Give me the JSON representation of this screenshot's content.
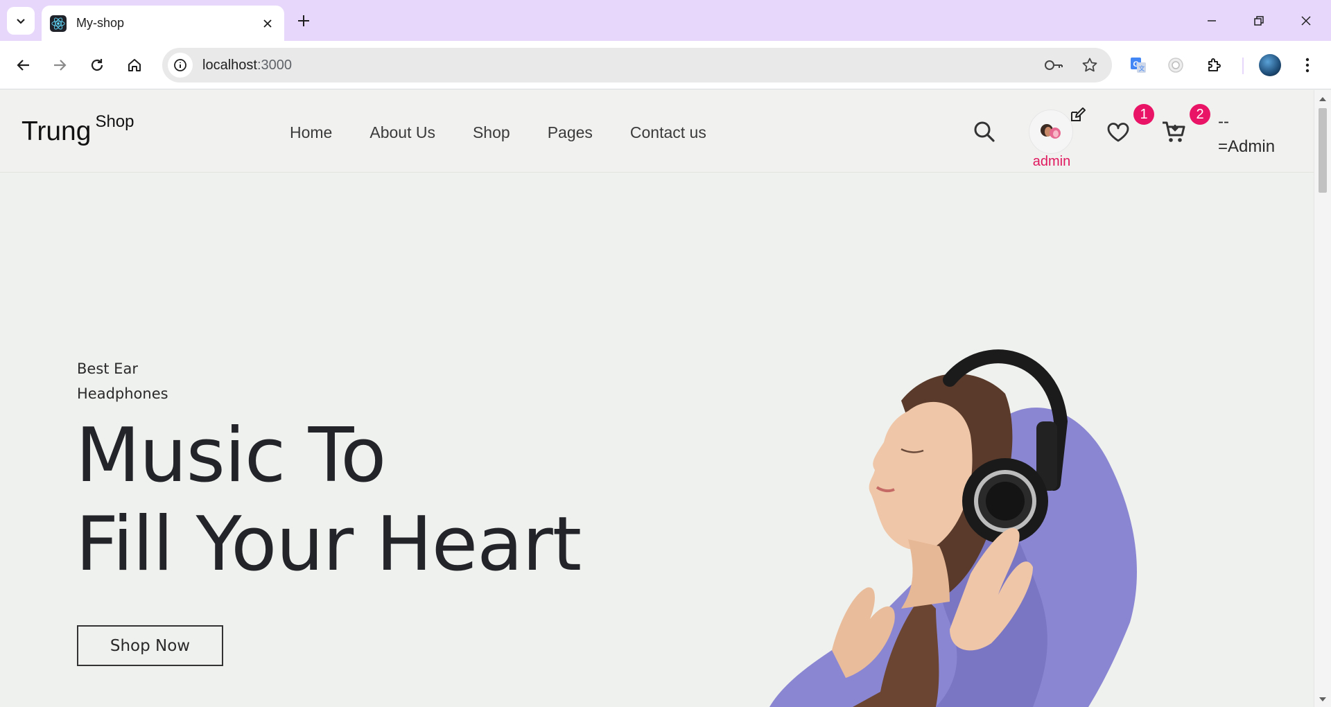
{
  "browser": {
    "tab_title": "My-shop",
    "url_host": "localhost",
    "url_port": ":3000",
    "icons": [
      "tab-search-icon",
      "react-favicon",
      "close-icon",
      "plus-icon",
      "minimize-icon",
      "restore-icon",
      "window-close-icon",
      "back-icon",
      "forward-icon",
      "reload-icon",
      "home-icon",
      "site-info-icon",
      "key-icon",
      "star-icon",
      "translate-icon",
      "extension-icon",
      "puzzle-icon",
      "menu-icon"
    ]
  },
  "site": {
    "logo": "Trung",
    "logo_sup": "Shop",
    "nav": [
      "Home",
      "About Us",
      "Shop",
      "Pages",
      "Contact us"
    ],
    "username": "admin",
    "wishlist_count": "1",
    "cart_count": "2",
    "role_label": "--\n=Admin",
    "accent_color": "#e0185e"
  },
  "hero": {
    "kicker": "Best Ear Headphones",
    "title_line1": "Music To",
    "title_line2": "Fill Your Heart",
    "button": "Shop Now",
    "image": "woman-with-headphones-purple-hoodie"
  }
}
